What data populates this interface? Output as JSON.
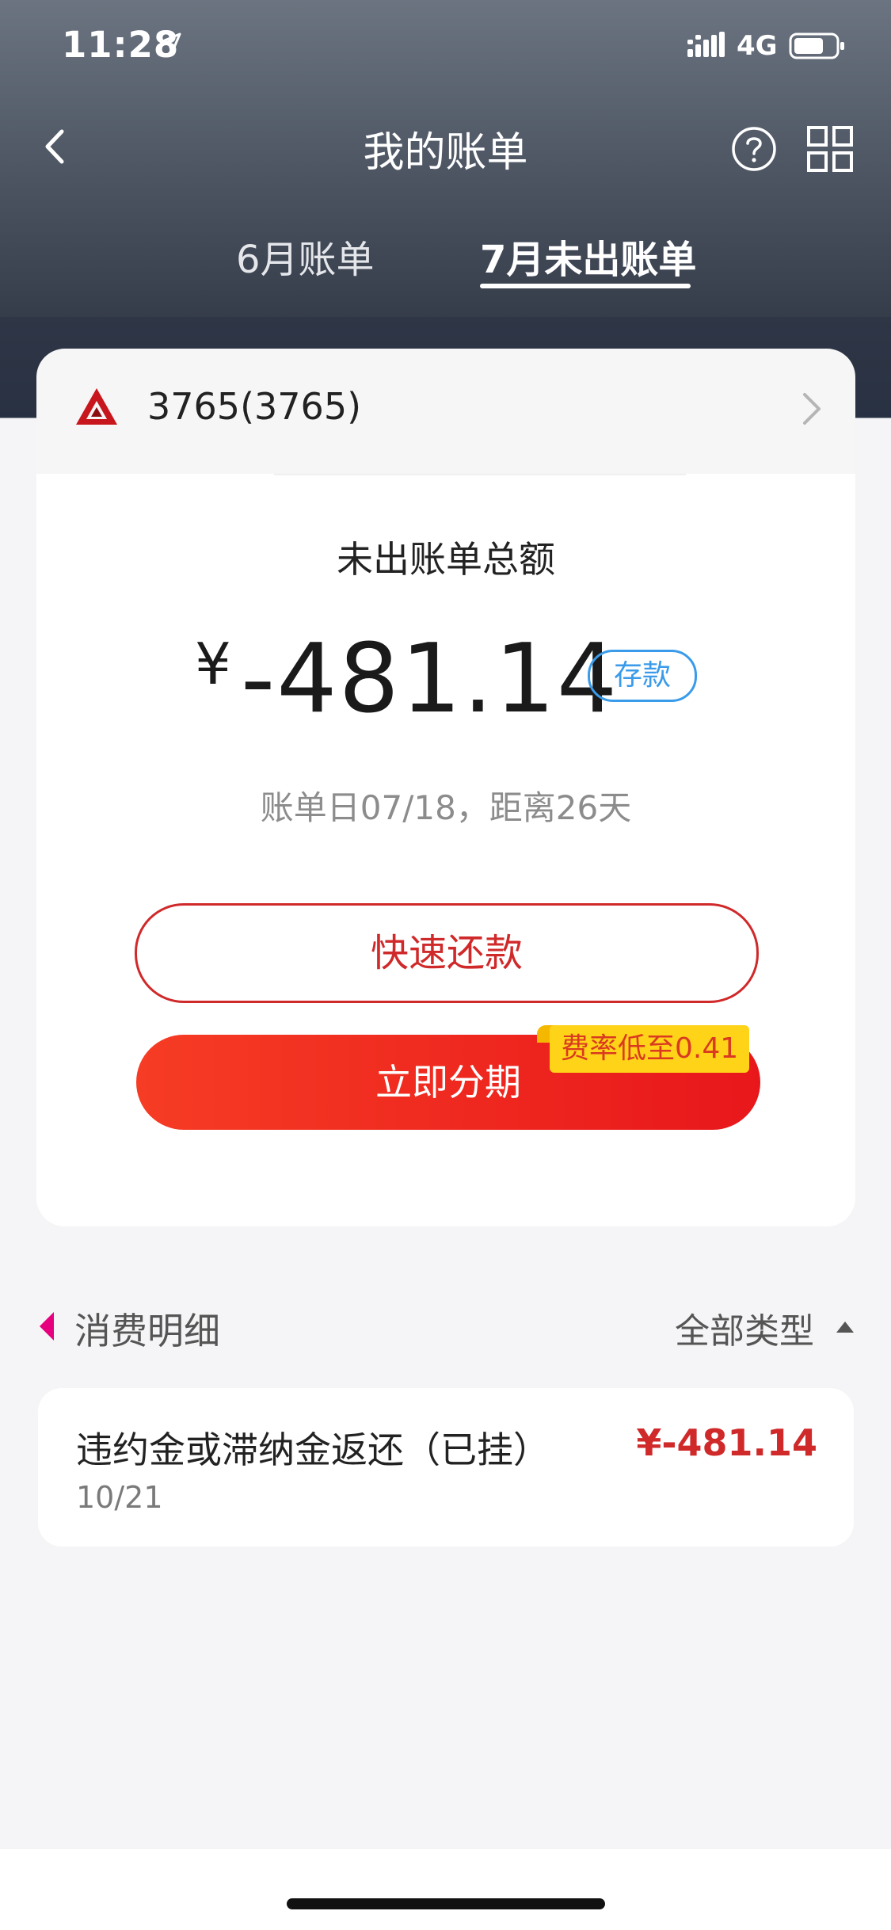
{
  "status_bar": {
    "time": "11:28",
    "network": "4G"
  },
  "nav": {
    "title": "我的账单",
    "help_icon": "question-circle-icon",
    "grid_icon": "grid-icon"
  },
  "tabs": [
    {
      "label": "6月账单",
      "active": false
    },
    {
      "label": "7月未出账单",
      "active": true
    }
  ],
  "account": {
    "number": "3765(3765)",
    "logo_color": "#c8161d"
  },
  "summary": {
    "label": "未出账单总额",
    "currency": "¥",
    "amount": "-481.14",
    "badge": "存款",
    "bill_date": "账单日07/18，距离26天"
  },
  "actions": {
    "quick_pay": "快速还款",
    "installment": "立即分期",
    "rate_tag": "费率低至0.41"
  },
  "details": {
    "title": "消费明细",
    "filter": "全部类型"
  },
  "transactions": [
    {
      "title": "违约金或滞纳金返还（已挂）",
      "date": "10/21",
      "amount": "¥-481.14"
    }
  ],
  "colors": {
    "accent_red": "#d0292a",
    "badge_blue": "#3a9bea",
    "tag_yellow": "#ffd318",
    "marker_pink": "#e6007e"
  }
}
